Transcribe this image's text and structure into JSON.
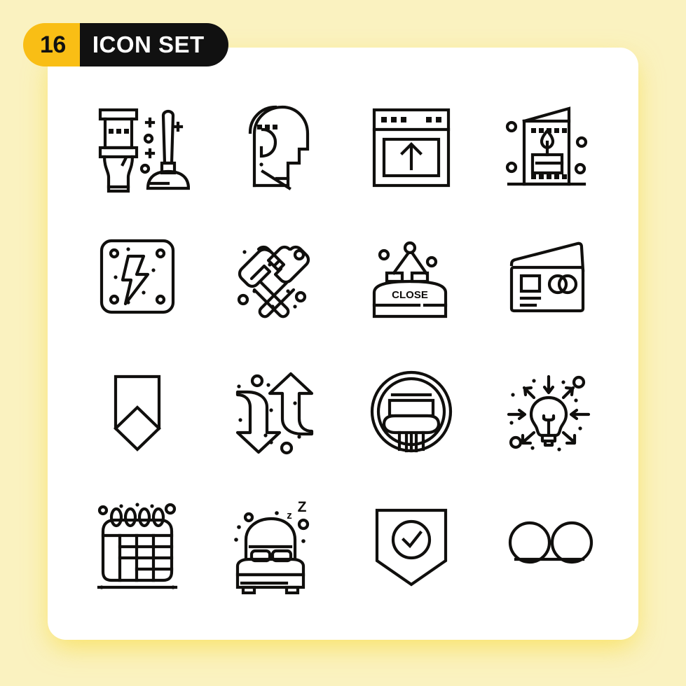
{
  "badge": {
    "count": "16",
    "title": "ICON SET",
    "count_bg": "#F9BE15",
    "title_bg": "#111111",
    "title_color": "#FFFFFF"
  },
  "canvas": {
    "background": "#FAF2C0",
    "card_background": "#FFFFFF",
    "stroke_color": "#100F0D",
    "glow_color": "#F8D61C"
  },
  "grid": {
    "columns": 4,
    "rows": 4,
    "total": 16
  },
  "icons": [
    {
      "index": 1,
      "name": "toilet-plunger-icon",
      "label": "toilet and plunger"
    },
    {
      "index": 2,
      "name": "head-question-icon",
      "label": "head with question mark"
    },
    {
      "index": 3,
      "name": "browser-upload-icon",
      "label": "browser window upload"
    },
    {
      "index": 4,
      "name": "greeting-card-candle-icon",
      "label": "greeting card with candle"
    },
    {
      "index": 5,
      "name": "electric-panel-bolt-icon",
      "label": "lightning bolt panel"
    },
    {
      "index": 6,
      "name": "crossed-hammers-icon",
      "label": "crossed hammers"
    },
    {
      "index": 7,
      "name": "close-sign-icon",
      "label": "hanging close sign",
      "text": "CLOSE"
    },
    {
      "index": 8,
      "name": "credit-card-icon",
      "label": "credit cards"
    },
    {
      "index": 9,
      "name": "bookmark-banner-icon",
      "label": "bookmark banner"
    },
    {
      "index": 10,
      "name": "transfer-arrows-icon",
      "label": "up down transfer arrows"
    },
    {
      "index": 11,
      "name": "pillar-circle-icon",
      "label": "classical pillar in circle"
    },
    {
      "index": 12,
      "name": "lightbulb-arrows-icon",
      "label": "lightbulb with inward arrows"
    },
    {
      "index": 13,
      "name": "calendar-grid-icon",
      "label": "spiral calendar"
    },
    {
      "index": 14,
      "name": "bed-sleep-icon",
      "label": "bed with sleep z letters",
      "text": "Z z"
    },
    {
      "index": 15,
      "name": "shield-check-icon",
      "label": "shield with checkmark"
    },
    {
      "index": 16,
      "name": "two-circles-link-icon",
      "label": "two linked circles"
    }
  ]
}
